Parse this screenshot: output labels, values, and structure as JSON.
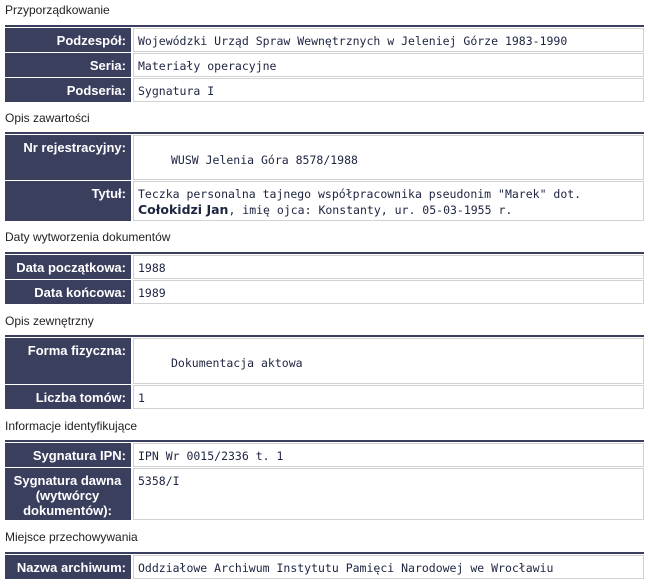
{
  "sections": {
    "przyporzadkowanie": "Przyporządkowanie",
    "opis_zawartosci": "Opis zawartości",
    "daty": "Daty wytworzenia dokumentów",
    "opis_zewnetrzny": "Opis zewnętrzny",
    "informacje": "Informacje identyfikujące",
    "miejsce": "Miejsce przechowywania"
  },
  "fields": {
    "podzespol": {
      "label": "Podzespół:",
      "value": "Wojewódzki Urząd Spraw Wewnętrznych w Jeleniej Górze 1983-1990"
    },
    "seria": {
      "label": "Seria:",
      "value": "Materiały operacyjne"
    },
    "podseria": {
      "label": "Podseria:",
      "value": "Sygnatura I"
    },
    "nr_rejestracyjny": {
      "label": "Nr rejestracyjny:",
      "value": "WUSW Jelenia Góra 8578/1988"
    },
    "tytul": {
      "label": "Tytuł:",
      "value_prefix": "Teczka personalna tajnego współpracownika pseudonim \"Marek\" dot. ",
      "value_bold": "Cołokidzi Jan",
      "value_suffix": ", imię ojca: Konstanty, ur. 05-03-1955 r."
    },
    "data_poczatkowa": {
      "label": "Data początkowa:",
      "value": "1988"
    },
    "data_koncowa": {
      "label": "Data końcowa:",
      "value": "1989"
    },
    "forma_fizyczna": {
      "label": "Forma fizyczna:",
      "value": "Dokumentacja aktowa"
    },
    "liczba_tomow": {
      "label": "Liczba tomów:",
      "value": "1"
    },
    "sygnatura_ipn": {
      "label": "Sygnatura IPN:",
      "value": "IPN Wr 0015/2336 t. 1"
    },
    "sygnatura_dawna": {
      "label": "Sygnatura dawna (wytwórcy dokumentów):",
      "value": "5358/I"
    },
    "nazwa_archiwum": {
      "label": "Nazwa archiwum:",
      "value": "Oddziałowe Archiwum Instytutu Pamięci Narodowej we Wrocławiu"
    }
  },
  "colors": {
    "label_bg": "#3b3f5e",
    "label_text": "#ffffff",
    "value_text": "#1d2440",
    "border": "#d2d2d2"
  }
}
